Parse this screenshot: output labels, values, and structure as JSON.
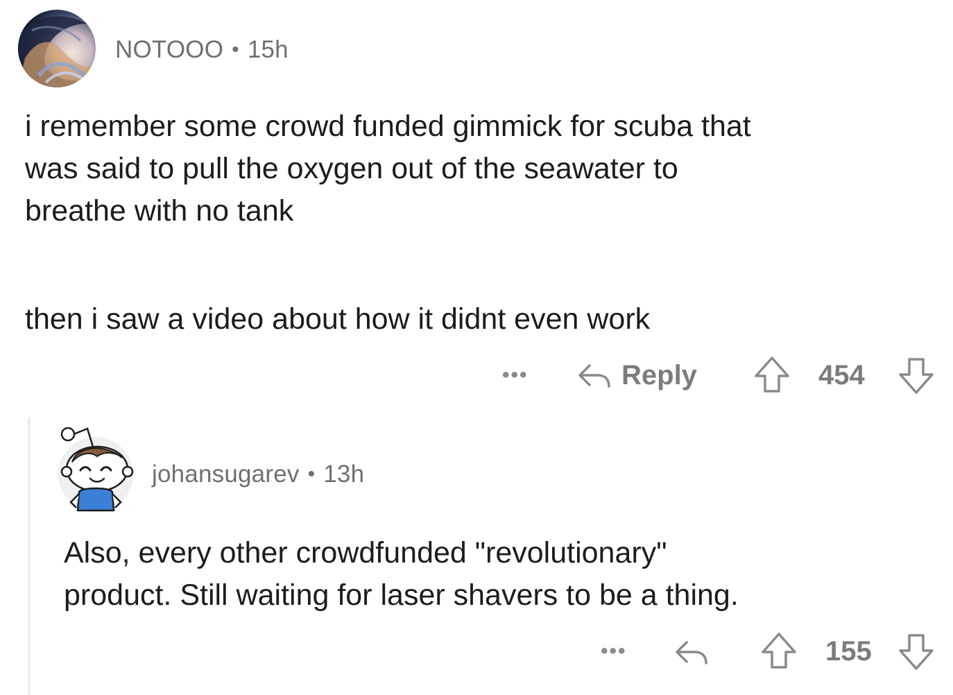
{
  "comments": [
    {
      "author": "NOTOOO",
      "time": "15h",
      "separator": "•",
      "avatar_icon": "wave-avatar-icon",
      "paragraphs": [
        "i remember some crowd funded gimmick for scuba that\nwas said to pull the oxygen out of the seawater to\nbreathe with no tank",
        "then i saw a video about how it didnt even work"
      ],
      "more_label": "•••",
      "reply_label": "Reply",
      "score": "454"
    },
    {
      "author": "johansugarev",
      "time": "13h",
      "separator": "•",
      "avatar_icon": "snoo-avatar-icon",
      "paragraphs": [
        "Also, every other crowdfunded \"revolutionary\"\nproduct. Still waiting for laser shavers to be a thing."
      ],
      "more_label": "•••",
      "score": "155"
    }
  ],
  "colors": {
    "text": "#1c1c1c",
    "meta": "#6f6f6f",
    "action": "#7c7c7c",
    "thread_line": "#ececec"
  }
}
